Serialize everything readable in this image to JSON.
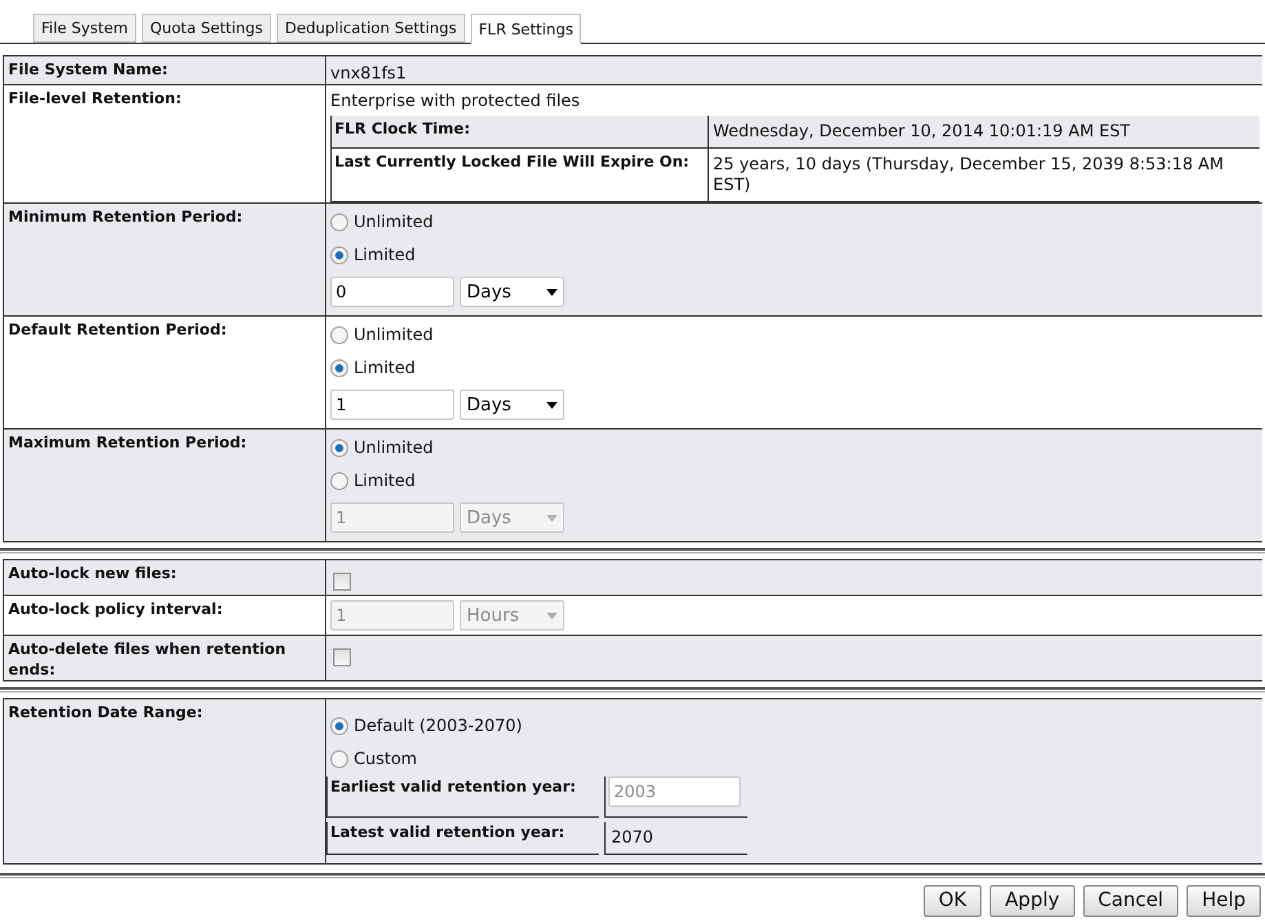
{
  "tabs": [
    {
      "label": "File System",
      "selected": false
    },
    {
      "label": "Quota Settings",
      "selected": false
    },
    {
      "label": "Deduplication Settings",
      "selected": false
    },
    {
      "label": "FLR Settings",
      "selected": true
    }
  ],
  "groups": [
    {
      "rows": [
        {
          "kind": "text",
          "label": "File System Name:",
          "value": "vnx81fs1"
        },
        {
          "kind": "flr",
          "label": "File-level Retention:",
          "value": "Enterprise with protected files",
          "details": [
            {
              "label": "FLR Clock Time:",
              "value": "Wednesday, December 10, 2014 10:01:19 AM EST"
            },
            {
              "label": "Last Currently Locked File Will Expire On:",
              "value": "25 years, 10 days (Thursday, December 15, 2039 8:53:18 AM EST)"
            }
          ]
        },
        {
          "kind": "period",
          "label": "Minimum Retention Period:",
          "options": [
            {
              "label": "Unlimited",
              "selected": false
            },
            {
              "label": "Limited",
              "selected": true
            }
          ],
          "amount": "0",
          "unit": "Days",
          "disabled": false
        },
        {
          "kind": "period",
          "label": "Default Retention Period:",
          "options": [
            {
              "label": "Unlimited",
              "selected": false
            },
            {
              "label": "Limited",
              "selected": true
            }
          ],
          "amount": "1",
          "unit": "Days",
          "disabled": false
        },
        {
          "kind": "period",
          "label": "Maximum Retention Period:",
          "options": [
            {
              "label": "Unlimited",
              "selected": true
            },
            {
              "label": "Limited",
              "selected": false
            }
          ],
          "amount": "1",
          "unit": "Days",
          "disabled": true
        }
      ]
    },
    {
      "rows": [
        {
          "kind": "checkbox",
          "label": "Auto-lock new files:",
          "checked": false
        },
        {
          "kind": "interval",
          "label": "Auto-lock policy interval:",
          "amount": "1",
          "unit": "Hours",
          "disabled": true
        },
        {
          "kind": "checkbox",
          "label": "Auto-delete files when retention ends:",
          "checked": false
        }
      ]
    },
    {
      "rows": [
        {
          "kind": "range",
          "label": "Retention Date Range:",
          "options": [
            {
              "label": "Default (2003-2070)",
              "selected": true
            },
            {
              "label": "Custom",
              "selected": false
            }
          ],
          "earliest": {
            "label": "Earliest valid retention year:",
            "value": "2003"
          },
          "latest": {
            "label": "Latest valid retention year:",
            "value": "2070"
          }
        }
      ]
    }
  ],
  "buttons": [
    "OK",
    "Apply",
    "Cancel",
    "Help"
  ]
}
